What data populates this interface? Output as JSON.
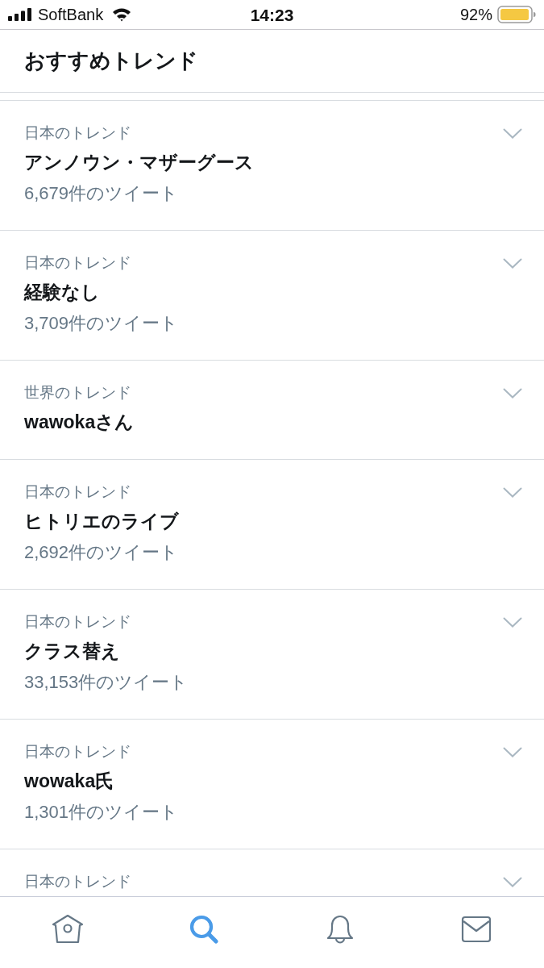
{
  "status_bar": {
    "carrier": "SoftBank",
    "time": "14:23",
    "battery": "92%"
  },
  "header": {
    "title": "おすすめトレンド"
  },
  "trends": [
    {
      "context": "日本のトレンド",
      "name": "アンノウン・マザーグース",
      "tweets": "6,679件のツイート"
    },
    {
      "context": "日本のトレンド",
      "name": "経験なし",
      "tweets": "3,709件のツイート"
    },
    {
      "context": "世界のトレンド",
      "name": "wawokaさん"
    },
    {
      "context": "日本のトレンド",
      "name": "ヒトリエのライブ",
      "tweets": "2,692件のツイート"
    },
    {
      "context": "日本のトレンド",
      "name": "クラス替え",
      "tweets": "33,153件のツイート"
    },
    {
      "context": "日本のトレンド",
      "name": "wowaka氏",
      "tweets": "1,301件のツイート"
    },
    {
      "context": "日本のトレンド"
    }
  ],
  "tab_bar": [
    {
      "kind": "home",
      "selected": false
    },
    {
      "kind": "search",
      "selected": true
    },
    {
      "kind": "notifications",
      "selected": false
    },
    {
      "kind": "messages",
      "selected": false
    }
  ]
}
